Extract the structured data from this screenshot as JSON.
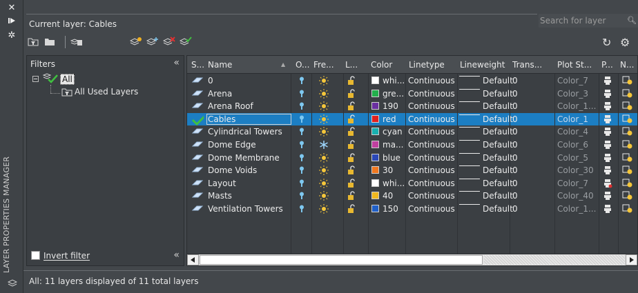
{
  "palette": {
    "panel_bg": "#3b3f43",
    "window_bg": "#43474b",
    "selection": "#1c7ec3"
  },
  "window": {
    "vertical_title": "LAYER PROPERTIES MANAGER",
    "icons": [
      "close-icon",
      "pin-icon",
      "settings-icon",
      "layers-icon"
    ]
  },
  "header": {
    "current_layer": "Current layer: Cables",
    "search_placeholder": "Search for layer"
  },
  "toolbar": {
    "icons": [
      "new-property-filter-icon",
      "new-group-filter-icon",
      "layer-states-manager-icon",
      "new-layer-icon",
      "new-layer-vp-frozen-icon",
      "delete-layer-icon",
      "set-current-icon",
      "refresh-icon",
      "settings-icon"
    ]
  },
  "filters": {
    "title": "Filters",
    "collapse": "«",
    "tree": [
      {
        "label": "All",
        "selected": true
      },
      {
        "label": "All Used Layers",
        "selected": false
      }
    ],
    "invert_filter": "Invert filter",
    "collapse_bottom": "«"
  },
  "columns": [
    "S...",
    "Name",
    "O...",
    "Fre...",
    "L...",
    "Color",
    "Linetype",
    "Lineweight",
    "Trans...",
    "Plot St...",
    "P...",
    "N..."
  ],
  "layers": [
    {
      "name": "0",
      "status": "layer",
      "on": true,
      "frozen": false,
      "locked": false,
      "color_hex": "#ffffff",
      "color": "whi...",
      "linetype": "Continuous",
      "lineweight": "Default",
      "transparency": "0",
      "plot_style": "Color_7",
      "plot": true
    },
    {
      "name": "Arena",
      "status": "layer",
      "on": true,
      "frozen": false,
      "locked": false,
      "color_hex": "#22b14c",
      "color": "gre...",
      "linetype": "Continuous",
      "lineweight": "Default",
      "transparency": "0",
      "plot_style": "Color_3",
      "plot": true
    },
    {
      "name": "Arena Roof",
      "status": "layer",
      "on": true,
      "frozen": false,
      "locked": false,
      "color_hex": "#6a2fa0",
      "color": "190",
      "linetype": "Continuous",
      "lineweight": "Default",
      "transparency": "0",
      "plot_style": "Color_1...",
      "plot": true
    },
    {
      "name": "Cables",
      "status": "current",
      "on": true,
      "frozen": false,
      "locked": false,
      "color_hex": "#e02020",
      "color": "red",
      "linetype": "Continuous",
      "lineweight": "Default",
      "transparency": "0",
      "plot_style": "Color_1",
      "plot": true,
      "selected": true
    },
    {
      "name": "Cylindrical Towers",
      "status": "layer",
      "on": true,
      "frozen": false,
      "locked": false,
      "color_hex": "#18b0b0",
      "color": "cyan",
      "linetype": "Continuous",
      "lineweight": "Default",
      "transparency": "0",
      "plot_style": "Color_4",
      "plot": true
    },
    {
      "name": "Dome Edge",
      "status": "layer",
      "on": true,
      "frozen": true,
      "locked": false,
      "color_hex": "#c040a0",
      "color": "ma...",
      "linetype": "Continuous",
      "lineweight": "Default",
      "transparency": "0",
      "plot_style": "Color_6",
      "plot": true
    },
    {
      "name": "Dome Membrane",
      "status": "layer",
      "on": true,
      "frozen": false,
      "locked": false,
      "color_hex": "#2a48b8",
      "color": "blue",
      "linetype": "Continuous",
      "lineweight": "Default",
      "transparency": "0",
      "plot_style": "Color_5",
      "plot": true
    },
    {
      "name": "Dome Voids",
      "status": "layer",
      "on": true,
      "frozen": false,
      "locked": false,
      "color_hex": "#f07820",
      "color": "30",
      "linetype": "Continuous",
      "lineweight": "Default",
      "transparency": "0",
      "plot_style": "Color_30",
      "plot": true
    },
    {
      "name": "Layout",
      "status": "layer",
      "on": true,
      "frozen": false,
      "locked": false,
      "color_hex": "#ffffff",
      "color": "whi...",
      "linetype": "Continuous",
      "lineweight": "Default",
      "transparency": "0",
      "plot_style": "Color_7",
      "plot": false
    },
    {
      "name": "Masts",
      "status": "layer",
      "on": true,
      "frozen": false,
      "locked": false,
      "color_hex": "#f0b820",
      "color": "40",
      "linetype": "Continuous",
      "lineweight": "Default",
      "transparency": "0",
      "plot_style": "Color_40",
      "plot": true
    },
    {
      "name": "Ventilation Towers",
      "status": "layer",
      "on": true,
      "frozen": false,
      "locked": false,
      "color_hex": "#2060c8",
      "color": "150",
      "linetype": "Continuous",
      "lineweight": "Default",
      "transparency": "0",
      "plot_style": "Color_1...",
      "plot": true
    }
  ],
  "status_bar": "All: 11 layers displayed of 11 total layers"
}
